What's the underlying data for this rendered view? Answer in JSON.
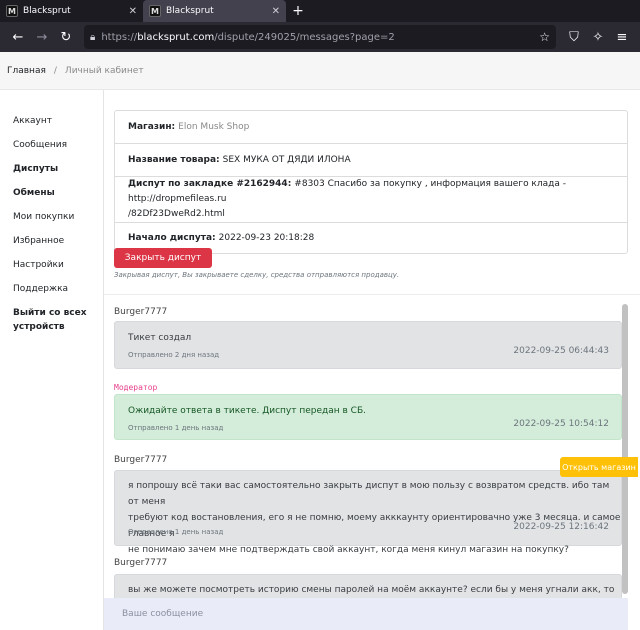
{
  "browser": {
    "tabs": [
      {
        "title": "Blacksprut",
        "favicon": "M"
      },
      {
        "title": "Blacksprut",
        "favicon": "M"
      }
    ],
    "url": {
      "proto": "https://",
      "host": "blacksprut.com",
      "path": "/dispute/249025/messages?page=2"
    }
  },
  "breadcrumb": {
    "home": "Главная",
    "separator": "/",
    "current": "Личный кабинет"
  },
  "sidebar": {
    "items": [
      {
        "label": "Аккаунт"
      },
      {
        "label": "Сообщения"
      },
      {
        "label": "Диспуты"
      },
      {
        "label": "Обмены"
      },
      {
        "label": "Мои покупки"
      },
      {
        "label": "Избранное"
      },
      {
        "label": "Настройки"
      },
      {
        "label": "Поддержка"
      },
      {
        "label": "Выйти со всех устройств"
      }
    ]
  },
  "dispute": {
    "store_label": "Магазин:",
    "store_value": "Elon Musk Shop",
    "product_label": "Название товара:",
    "product_value": "SEX МУКА ОТ ДЯДИ ИЛОНА",
    "bookmark_label": "Диспут по закладке #2162944:",
    "bookmark_value_line1": "#8303 Спасибо за покупку , информация вашего клада - http://dropmefileas.ru",
    "bookmark_value_line2": "/82Df23DweRd2.html",
    "start_label": "Начало диспута:",
    "start_value": "2022-09-23 20:18:28",
    "close_button": "Закрыть диспут",
    "close_hint": "Закрывая диспут, Вы закрываете сделку, средства отправляются продавцу."
  },
  "messages": [
    {
      "author": "Burger7777",
      "text": "Тикет создал",
      "sent": "Отправлено 2 дня назад",
      "date": "2022-09-25 06:44:43"
    },
    {
      "author": "Модератор",
      "text": "Ожидайте ответа в тикете. Диспут передан в СБ.",
      "sent": "Отправлено 1 день назад",
      "date": "2022-09-25 10:54:12"
    },
    {
      "author": "Burger7777",
      "text_lines": [
        "я попрошу всё таки вас самостоятельно закрыть диспут в мою пользу с возвратом средств. ибо там от меня",
        "требуют код востановления, его я не помню, моему акккаунту ориентировачно уже 3 месяца. и самое главное я",
        "не понимаю зачем мне подтверждать свой аккаунт, когда меня кинул магазин на покупку?"
      ],
      "sent": "Отправлено 1 день назад",
      "date": "2022-09-25 12:16:42"
    },
    {
      "author": "Burger7777",
      "text": "вы же можете посмотреть историю смены паролей на моём аккаунте? если бы у меня угнали акк, то"
    }
  ],
  "open_store_button": "Открыть магазин",
  "composer": {
    "placeholder": "Ваше сообщение"
  }
}
